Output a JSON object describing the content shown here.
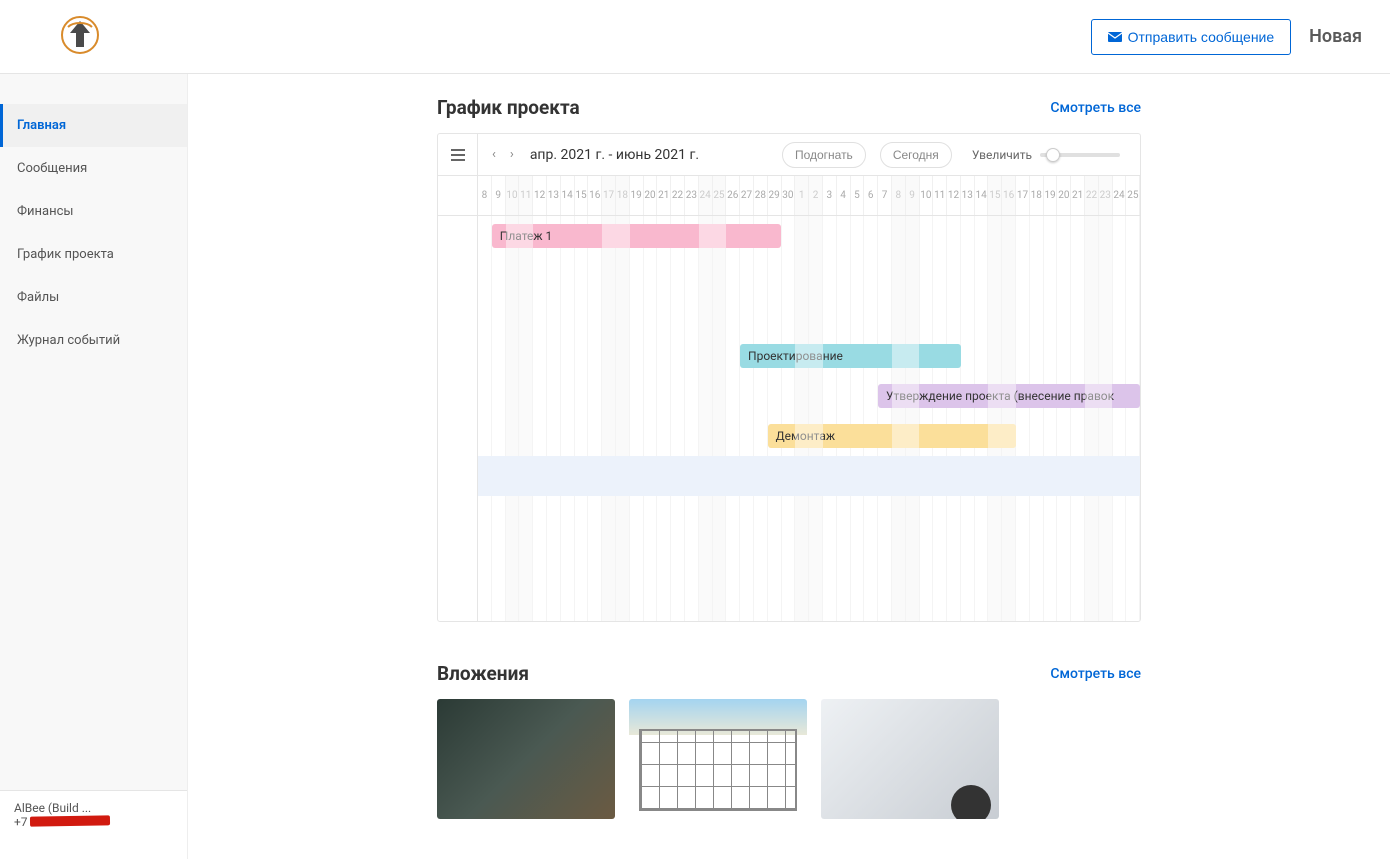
{
  "header": {
    "send_message_label": "Отправить сообщение",
    "status": "Новая"
  },
  "sidebar": {
    "items": [
      {
        "label": "Главная",
        "active": true
      },
      {
        "label": "Сообщения",
        "active": false
      },
      {
        "label": "Финансы",
        "active": false
      },
      {
        "label": "График проекта",
        "active": false
      },
      {
        "label": "Файлы",
        "active": false
      },
      {
        "label": "Журнал событий",
        "active": false
      }
    ],
    "footer": {
      "name": "AlBee (Build ...",
      "phone_prefix": "+7 9"
    }
  },
  "sections": {
    "gantt": {
      "title": "График проекта",
      "view_all": "Смотреть все",
      "toolbar": {
        "range": "апр. 2021 г. - июнь 2021 г.",
        "fit": "Подогнать",
        "today": "Сегодня",
        "zoom": "Увеличить"
      }
    },
    "attachments": {
      "title": "Вложения",
      "view_all": "Смотреть все"
    }
  },
  "chart_data": {
    "type": "gantt",
    "days": [
      "8",
      "9",
      "10",
      "11",
      "12",
      "13",
      "14",
      "15",
      "16",
      "17",
      "18",
      "19",
      "20",
      "21",
      "22",
      "23",
      "24",
      "25",
      "26",
      "27",
      "28",
      "29",
      "30",
      "1",
      "2",
      "3",
      "4",
      "5",
      "6",
      "7",
      "8",
      "9",
      "10",
      "11",
      "12",
      "13",
      "14",
      "15",
      "16",
      "17",
      "18",
      "19",
      "20",
      "21",
      "22",
      "23",
      "24",
      "25"
    ],
    "weekend_idx": [
      2,
      3,
      9,
      10,
      16,
      17,
      23,
      24,
      30,
      31,
      37,
      38,
      44,
      45
    ],
    "bars": [
      {
        "label": "Платеж 1",
        "row": 0,
        "start_idx": 1,
        "span": 21,
        "color": "pink"
      },
      {
        "label": "Проектирование",
        "row": 3,
        "start_idx": 19,
        "span": 16,
        "color": "cyan"
      },
      {
        "label": "Утверждение проекта (внесение правок",
        "row": 4,
        "start_idx": 29,
        "span": 19,
        "color": "purple"
      },
      {
        "label": "Демонтаж",
        "row": 5,
        "start_idx": 21,
        "span": 18,
        "color": "yellow"
      }
    ],
    "highlight_row": 6
  }
}
